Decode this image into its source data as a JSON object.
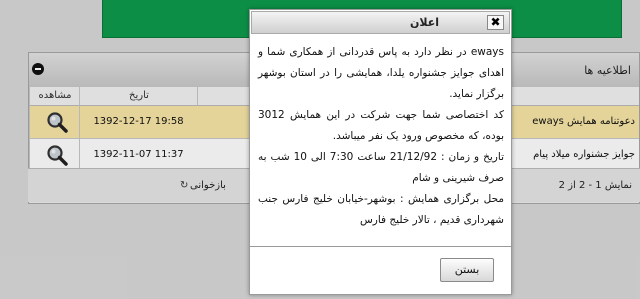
{
  "panel": {
    "title": "اطلاعیه ها",
    "columns": {
      "view": "مشاهده",
      "date": "تاریخ"
    },
    "rows": [
      {
        "date": "1392-12-17 19:58",
        "title": "دعوتنامه همایش eways"
      },
      {
        "date": "1392-11-07 11:37",
        "title": "جوایز جشنواره میلاد پیام"
      }
    ],
    "pager": {
      "left": "نمایش 1 - 2 از 2",
      "refresh": "بازخوانی",
      "select_glyph": "▾"
    }
  },
  "dialog": {
    "title": "اعلان",
    "close_glyph": "✖",
    "paragraphs": [
      "eways در نظر دارد به پاس قدردانی از همکاری شما و اهدای جوایز جشنواره یلدا، همایشی را در استان بوشهر برگزار نماید.",
      "کد اختصاصی شما جهت شرکت در این همایش 3012 بوده، که مخصوص ورود یک نفر میباشد.",
      "تاریخ و زمان : 21/12/92 ساعت 7:30 الی 10 شب به صرف شیرینی و شام",
      "محل برگزاری همایش : بوشهر-خیابان خلیج فارس جنب شهرداری قدیم ، تالار خلیج فارس"
    ],
    "button": "بستن"
  },
  "colors": {
    "banner": "#0e9b4c",
    "row_highlight": "#f8e7a8"
  },
  "icons": [
    "magnifier-icon",
    "close-icon",
    "refresh-icon",
    "collapse-icon",
    "dropdown-arrow-icon"
  ]
}
